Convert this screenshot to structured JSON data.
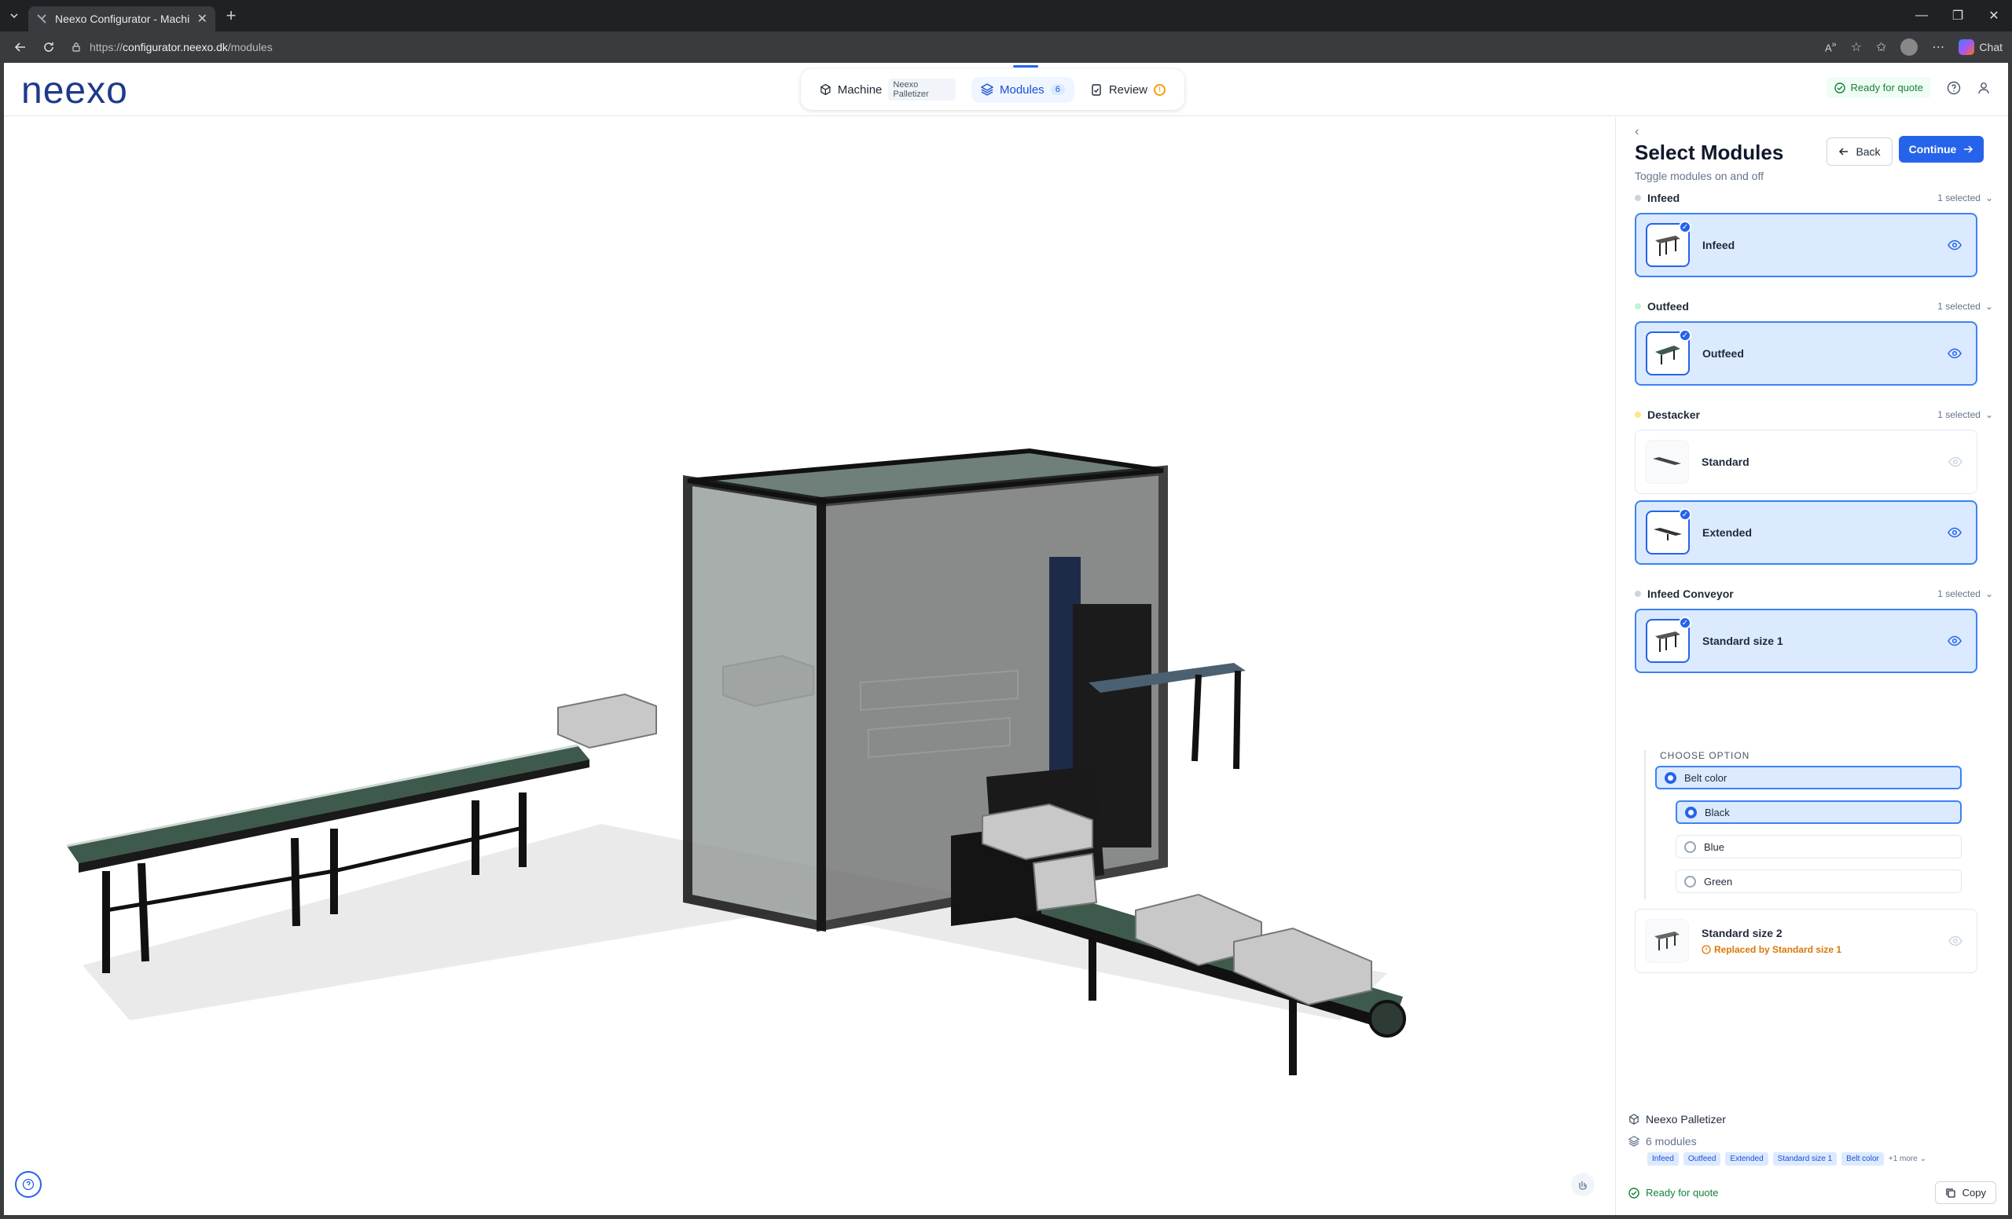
{
  "browser": {
    "tab_title": "Neexo Configurator - Machine Co",
    "url_prefix": "https://",
    "url_host": "configurator.neexo.dk",
    "url_path": "/modules",
    "chat_label": "Chat"
  },
  "header": {
    "logo": "neexo",
    "steps": {
      "machine": {
        "label": "Machine",
        "sub": "Neexo Palletizer"
      },
      "modules": {
        "label": "Modules",
        "badge": "6"
      },
      "review": {
        "label": "Review"
      }
    },
    "status": "Ready for quote"
  },
  "panel": {
    "title": "Select Modules",
    "subtitle": "Toggle modules on and off",
    "back_label": "Back",
    "continue_label": "Continue",
    "groups": [
      {
        "name": "Infeed",
        "count": "1 selected",
        "dot": "#cbd5e1"
      },
      {
        "name": "Outfeed",
        "count": "1 selected",
        "dot": "#bbf7d0"
      },
      {
        "name": "Destacker",
        "count": "1 selected",
        "dot": "#fde68a"
      },
      {
        "name": "Infeed Conveyor",
        "count": "1 selected",
        "dot": "#cbd5e1"
      }
    ],
    "cards": [
      {
        "name": "Infeed",
        "selected": true
      },
      {
        "name": "Outfeed",
        "selected": true
      },
      {
        "name": "Standard",
        "selected": false
      },
      {
        "name": "Extended",
        "selected": true
      },
      {
        "name": "Standard size 1",
        "selected": true
      },
      {
        "name": "Standard size 2",
        "selected": false,
        "note": "Replaced by Standard size 1"
      }
    ],
    "options": {
      "heading": "CHOOSE OPTION",
      "parent": "Belt color",
      "values": [
        "Black",
        "Blue",
        "Green"
      ],
      "selected": "Black"
    },
    "summary": {
      "machine": "Neexo Palletizer",
      "modules": "6 modules",
      "chips": [
        "Infeed",
        "Outfeed",
        "Extended",
        "Standard size 1",
        "Belt color"
      ],
      "more": "+1 more",
      "status": "Ready for quote",
      "copy_label": "Copy"
    }
  },
  "colors": {
    "accent": "#2563eb",
    "ready": "#15803d",
    "warning": "#f59e0b",
    "conveyor": "#3d5a4c"
  }
}
